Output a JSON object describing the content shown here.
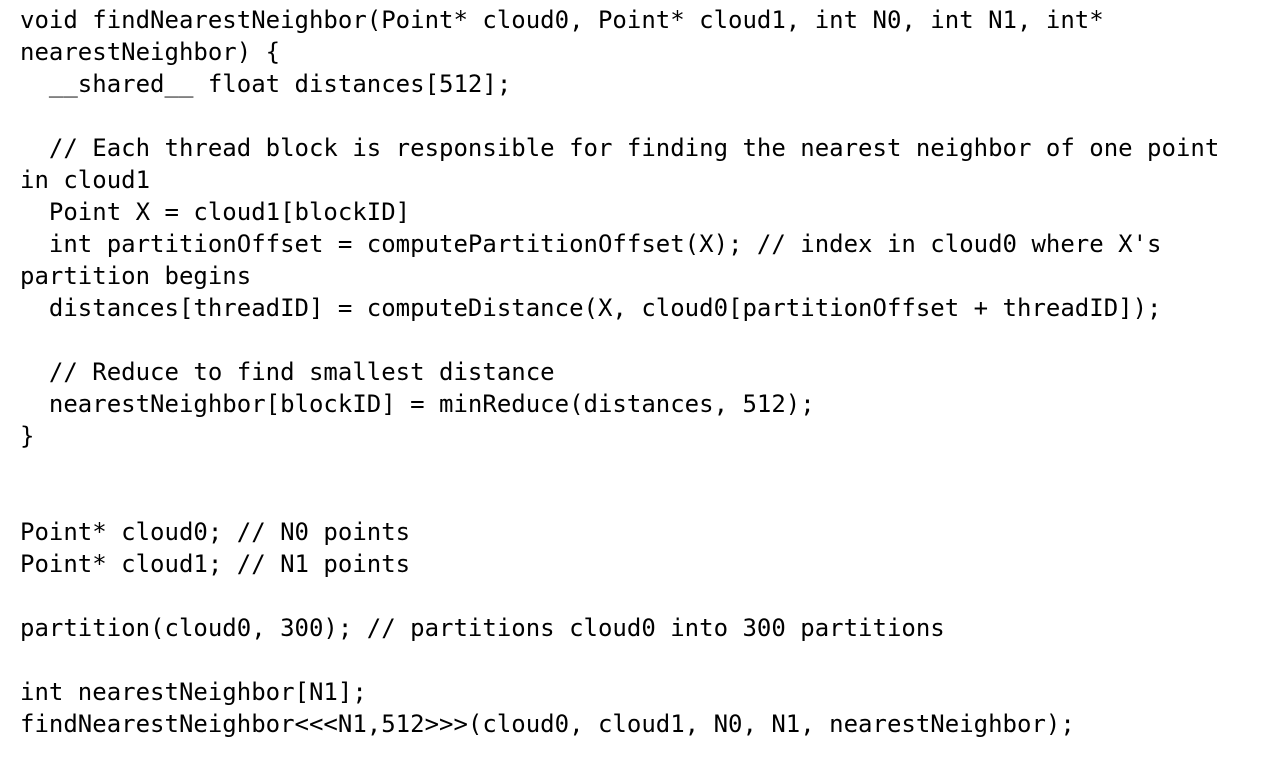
{
  "code_lines": [
    "void findNearestNeighbor(Point* cloud0, Point* cloud1, int N0, int N1, int*",
    "nearestNeighbor) {",
    "  __shared__ float distances[512];",
    "",
    "  // Each thread block is responsible for finding the nearest neighbor of one point",
    "in cloud1",
    "  Point X = cloud1[blockID]",
    "  int partitionOffset = computePartitionOffset(X); // index in cloud0 where X's",
    "partition begins",
    "  distances[threadID] = computeDistance(X, cloud0[partitionOffset + threadID]);",
    "",
    "  // Reduce to find smallest distance",
    "  nearestNeighbor[blockID] = minReduce(distances, 512);",
    "}",
    "",
    "",
    "Point* cloud0; // N0 points",
    "Point* cloud1; // N1 points",
    "",
    "partition(cloud0, 300); // partitions cloud0 into 300 partitions",
    "",
    "int nearestNeighbor[N1];",
    "findNearestNeighbor<<<N1,512>>>(cloud0, cloud1, N0, N1, nearestNeighbor);"
  ]
}
